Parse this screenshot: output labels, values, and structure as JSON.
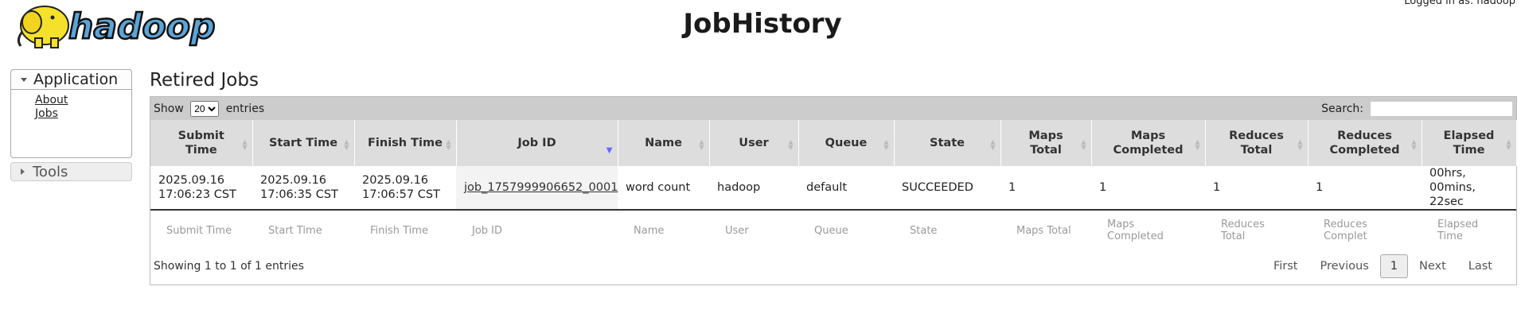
{
  "header": {
    "logo_text": "hadoop",
    "title": "JobHistory",
    "logged_in": "Logged in as: hadoop"
  },
  "nav": {
    "application_label": "Application",
    "links": [
      "About",
      "Jobs"
    ],
    "tools_label": "Tools"
  },
  "main": {
    "section_title": "Retired Jobs",
    "show_label": "Show",
    "entries_label": "entries",
    "page_size": "20",
    "search_label": "Search:",
    "search_value": "",
    "columns": [
      "Submit Time",
      "Start Time",
      "Finish Time",
      "Job ID",
      "Name",
      "User",
      "Queue",
      "State",
      "Maps Total",
      "Maps Completed",
      "Reduces Total",
      "Reduces Completed",
      "Elapsed Time"
    ],
    "footer_columns": [
      "Submit Time",
      "Start Time",
      "Finish Time",
      "Job ID",
      "Name",
      "User",
      "Queue",
      "State",
      "Maps Total",
      "Maps Completed",
      "Reduces Total",
      "Reduces Complet",
      "Elapsed Time"
    ],
    "rows": [
      [
        "2025.09.16 17:06:23 CST",
        "2025.09.16 17:06:35 CST",
        "2025.09.16 17:06:57 CST",
        "job_1757999906652_0001",
        "word count",
        "hadoop",
        "default",
        "SUCCEEDED",
        "1",
        "1",
        "1",
        "1",
        "00hrs, 00mins, 22sec"
      ]
    ],
    "info": "Showing 1 to 1 of 1 entries",
    "pager": {
      "first": "First",
      "previous": "Previous",
      "current": "1",
      "next": "Next",
      "last": "Last"
    }
  },
  "colors": {
    "header_bg": "#dddddd",
    "toolbar_bg": "#cccccc",
    "sort_active": "#6666ff"
  }
}
